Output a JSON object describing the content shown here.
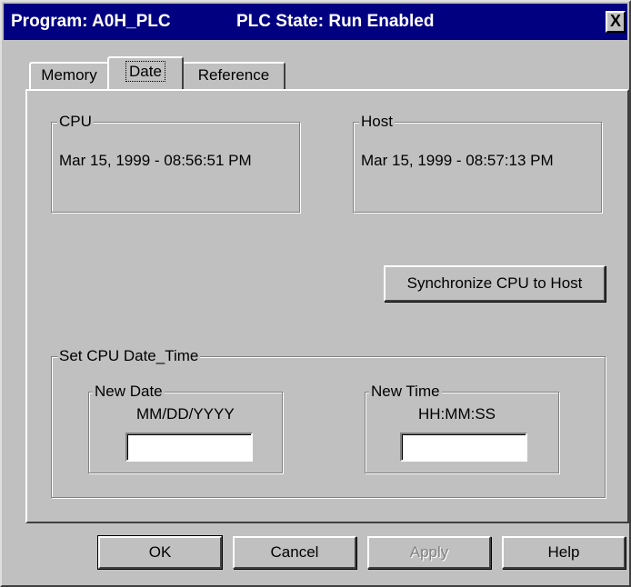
{
  "window": {
    "program_label": "Program: A0H_PLC",
    "state_label": "PLC State: Run Enabled",
    "close_glyph": "X"
  },
  "tabs": [
    {
      "label": "Memory",
      "active": false
    },
    {
      "label": "Date",
      "active": true
    },
    {
      "label": "Reference",
      "active": false
    }
  ],
  "cpu": {
    "label": "CPU",
    "value": "Mar 15, 1999 - 08:56:51 PM"
  },
  "host": {
    "label": "Host",
    "value": "Mar 15, 1999 - 08:57:13 PM"
  },
  "sync_button": "Synchronize CPU to Host",
  "set_group": {
    "label": "Set CPU Date_Time",
    "new_date": {
      "label": "New Date",
      "format": "MM/DD/YYYY",
      "value": ""
    },
    "new_time": {
      "label": "New Time",
      "format": "HH:MM:SS",
      "value": ""
    }
  },
  "buttons": {
    "ok": "OK",
    "cancel": "Cancel",
    "apply": "Apply",
    "help": "Help"
  }
}
